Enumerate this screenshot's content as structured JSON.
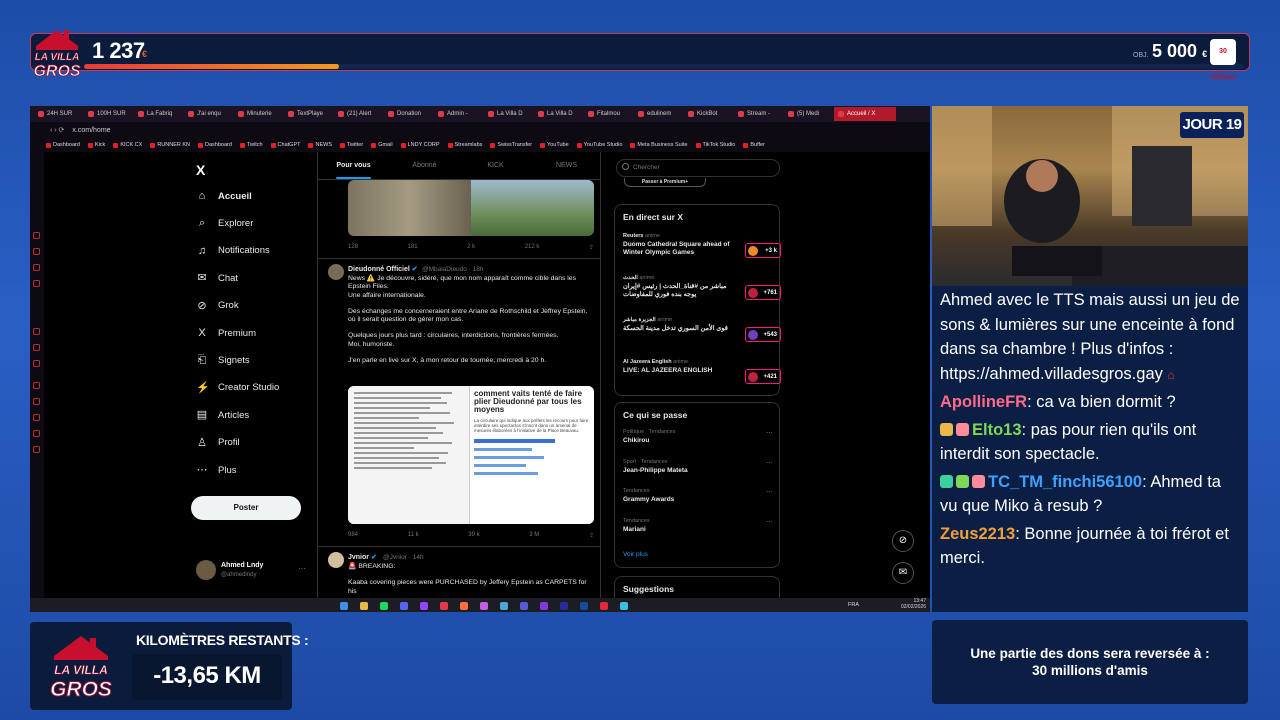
{
  "overlay": {
    "logo_top": "LA VILLA GROS",
    "counter_value": "1 237",
    "counter_unit": "€",
    "progress_fraction": 0.22,
    "goal_label": "OBJ.",
    "goal_value": "5 000",
    "goal_unit": "€",
    "goal_badge": "30 millions",
    "day_badge": "JOUR 19",
    "km_label": "KILOMÈTRES RESTANTS :",
    "km_value": "-13,65 KM",
    "donation_line1": "Une partie des dons sera reversée à :",
    "donation_line2": "30 millions d'amis",
    "accent_color": "#c23a5a",
    "panel_color": "#0b1e44"
  },
  "browser": {
    "tabs": [
      "24H SUR",
      "100H SUR",
      "La Fabriq",
      "J'ai enqu",
      "Minuterie",
      "TextPlaye",
      "(21) Alert",
      "Donation",
      "Admin -",
      "La Villa D",
      "La Villa D",
      "Fitalmou",
      "edulinem",
      "KickBot",
      "Stream -",
      "(5) Medi",
      "Accueil / X"
    ],
    "active_tab": "Accueil / X",
    "url": "x.com/home",
    "bookmarks": [
      "Dashboard",
      "Kick",
      "KICK CX",
      "RUNNER KN",
      "Dashboard",
      "Twitch",
      "ChatGPT",
      "NEWS",
      "Twitter",
      "Gmail",
      "LNDY CORP",
      "Streamlabs",
      "SwissTransfer",
      "YouTube",
      "YouTube Studio",
      "Meta Business Suite",
      "TikTok Studio",
      "Buffer"
    ]
  },
  "x_sidebar": {
    "logo": "X",
    "items": [
      {
        "label": "Accueil",
        "icon": "home-icon",
        "glyph": "⌂"
      },
      {
        "label": "Explorer",
        "icon": "search-icon",
        "glyph": "⌕"
      },
      {
        "label": "Notifications",
        "icon": "bell-icon",
        "glyph": "♫"
      },
      {
        "label": "Chat",
        "icon": "mail-icon",
        "glyph": "✉"
      },
      {
        "label": "Grok",
        "icon": "grok-icon",
        "glyph": "⊘"
      },
      {
        "label": "Premium",
        "icon": "x-premium-icon",
        "glyph": "X"
      },
      {
        "label": "Signets",
        "icon": "bookmark-icon",
        "glyph": "⎗"
      },
      {
        "label": "Creator Studio",
        "icon": "creator-icon",
        "glyph": "⚡"
      },
      {
        "label": "Articles",
        "icon": "article-icon",
        "glyph": "▤"
      },
      {
        "label": "Profil",
        "icon": "user-icon",
        "glyph": "♙"
      },
      {
        "label": "Plus",
        "icon": "more-icon",
        "glyph": "⋯"
      }
    ],
    "post_button": "Poster",
    "profile_name": "Ahmed Lndy",
    "profile_handle": "@ahmedlndy"
  },
  "feed": {
    "tabs": [
      "Pour vous",
      "Abonné",
      "KICK",
      "NEWS"
    ],
    "tweet1_actions": [
      "128",
      "181",
      "2 k",
      "212 k"
    ],
    "tweet2": {
      "name": "Dieudonné Officiel",
      "handle": "@MbalaDieudo · 18h",
      "text1": "News ⚠️ Je découvre, sidéré, que mon nom apparaît comme cible dans les Epstein Files.",
      "text2": "Une affaire internationale.",
      "text3": "Des échanges me concerneraient entre Ariane de Rothschild et Jeffrey Epstein, où il serait question de gérer mon cas.",
      "text4": "Quelques jours plus tard : circulaires, interdictions, frontières fermées.",
      "text5": "Moi, humoriste.",
      "text6": "J'en parle en live sur X, à mon retour de tournée, mercredi à 20 h.",
      "doc_title": "comment vaits tenté de faire plier Dieudonné par tous les moyens",
      "doc_sub": "La circulaire qui indique aux préfets les recours pour faire interdire ses spectacles s'inscrit dans un arsenal de mesures élaborées à l'initiative de la Place Beauvau.",
      "actions": [
        "984",
        "11 k",
        "39 k",
        "3 M"
      ]
    },
    "tweet3": {
      "name": "Jvnior",
      "handle": "@Jvnior · 14h",
      "text1": "🚨 BREAKING:",
      "text2": "Kaaba covering pieces were PURCHASED by Jeffery Epstein as CARPETS for his"
    }
  },
  "right_col": {
    "search_placeholder": "Chercher",
    "premium_btn": "Passer à Premium+",
    "live_title": "En direct sur X",
    "live": [
      {
        "source": "Reuters",
        "sub": "anime",
        "title": "Duomo Cathedral Square ahead of Winter Olympic Games",
        "count": "+3 k"
      },
      {
        "source": "الحدث",
        "sub": "anime",
        "title": "مباشر من #قناة_الحدث | رئيس #إيران يوجه بنده فوري للمفاوضات",
        "count": "+761"
      },
      {
        "source": "الجزيرة مباشر",
        "sub": "anime",
        "title": "قوى الأمن السوري تدخل مدينة الحسكة",
        "count": "+543"
      },
      {
        "source": "Al Jazeera English",
        "sub": "anime",
        "title": "LIVE: AL JAZEERA ENGLISH",
        "count": "+421"
      }
    ],
    "trends_title": "Ce qui se passe",
    "trends": [
      {
        "cat": "Politique · Tendances",
        "name": "Chikirou"
      },
      {
        "cat": "Sport · Tendances",
        "name": "Jean-Philippe Mateta"
      },
      {
        "cat": "Tendances",
        "name": "Grammy Awards"
      },
      {
        "cat": "Tendances",
        "name": "Mariani"
      }
    ],
    "see_more": "Voir plus",
    "suggestions_title": "Suggestions"
  },
  "taskbar": {
    "lang": "FRA",
    "time": "13:47",
    "date": "02/02/2026"
  },
  "chat": {
    "intro": "Ahmed avec le TTS mais aussi un jeu de sons & lumières sur une enceinte à fond dans sa chambre ! Plus d'infos : https://ahmed.villadesgros.gay",
    "messages": [
      {
        "user": "ApollineFR",
        "color": "#ff6b8a",
        "text": "ca va bien dormit ?"
      },
      {
        "user": "Elto13",
        "color": "#7dd85a",
        "text": "pas pour rien qu'ils ont interdit son spectacle."
      },
      {
        "user": "TC_TM_finchi56100",
        "color": "#3fa0ff",
        "text": "Ahmed ta vu que Miko à resub ?"
      },
      {
        "user": "Zeus2213",
        "color": "#f2a03a",
        "text": "Bonne journée à toi frérot et merci."
      }
    ]
  }
}
